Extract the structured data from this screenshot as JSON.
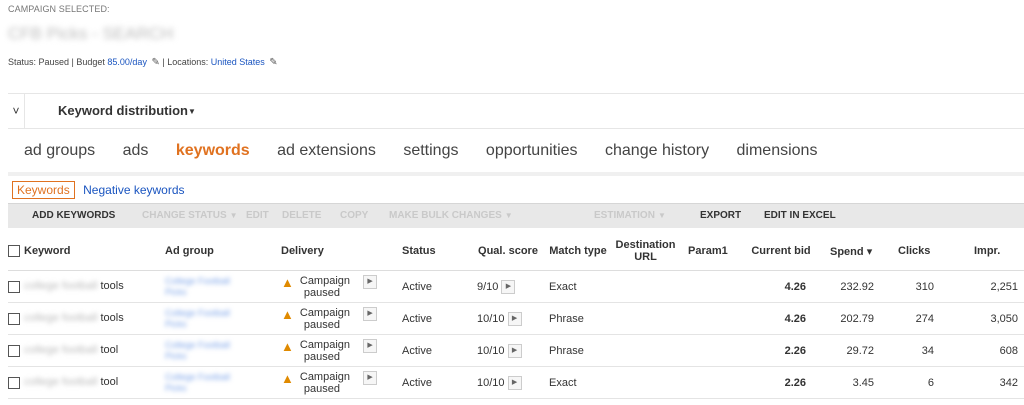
{
  "campaign": {
    "selected_label": "CAMPAIGN SELECTED:",
    "name": "CFB Picks - SEARCH",
    "status_label": "Status: Paused | Budget ",
    "budget": "85.00/day",
    "locations_label": "| Locations: ",
    "location": "United States"
  },
  "keyword_distribution": {
    "toggle": "˅",
    "title": "Keyword distribution"
  },
  "tabs": [
    {
      "label": "ad groups"
    },
    {
      "label": "ads"
    },
    {
      "label": "keywords"
    },
    {
      "label": "ad extensions"
    },
    {
      "label": "settings"
    },
    {
      "label": "opportunities"
    },
    {
      "label": "change history"
    },
    {
      "label": "dimensions"
    }
  ],
  "subtabs": {
    "keywords": "Keywords",
    "negative": "Negative keywords"
  },
  "toolbar": {
    "add_keywords": "ADD KEYWORDS",
    "change_status": "CHANGE STATUS",
    "edit": "EDIT",
    "delete": "DELETE",
    "copy": "COPY",
    "make_bulk_changes": "MAKE BULK CHANGES",
    "estimation": "ESTIMATION",
    "export": "EXPORT",
    "edit_in_excel": "EDIT IN EXCEL"
  },
  "columns": {
    "keyword": "Keyword",
    "ad_group": "Ad group",
    "delivery": "Delivery",
    "status": "Status",
    "qual_score": "Qual. score",
    "match_type": "Match type",
    "destination_url": "Destination URL",
    "param1": "Param1",
    "current_bid": "Current bid",
    "spend": "Spend",
    "clicks": "Clicks",
    "impr": "Impr."
  },
  "rows": [
    {
      "kw_blur": "college football",
      "kw": "tools",
      "ad_group_a": "College Football",
      "ad_group_b": "Picks",
      "delivery_a": "Campaign",
      "delivery_b": "paused",
      "status": "Active",
      "qual": "9/10",
      "match": "Exact",
      "dest": "",
      "param1": "",
      "bid": "4.26",
      "spend": "232.92",
      "clicks": "310",
      "impr": "2,251"
    },
    {
      "kw_blur": "college football",
      "kw": "tools",
      "ad_group_a": "College Football",
      "ad_group_b": "Picks",
      "delivery_a": "Campaign",
      "delivery_b": "paused",
      "status": "Active",
      "qual": "10/10",
      "match": "Phrase",
      "dest": "",
      "param1": "",
      "bid": "4.26",
      "spend": "202.79",
      "clicks": "274",
      "impr": "3,050"
    },
    {
      "kw_blur": "college football",
      "kw": "tool",
      "ad_group_a": "College Football",
      "ad_group_b": "Picks",
      "delivery_a": "Campaign",
      "delivery_b": "paused",
      "status": "Active",
      "qual": "10/10",
      "match": "Phrase",
      "dest": "",
      "param1": "",
      "bid": "2.26",
      "spend": "29.72",
      "clicks": "34",
      "impr": "608"
    },
    {
      "kw_blur": "college football",
      "kw": "tool",
      "ad_group_a": "College Football",
      "ad_group_b": "Picks",
      "delivery_a": "Campaign",
      "delivery_b": "paused",
      "status": "Active",
      "qual": "10/10",
      "match": "Exact",
      "dest": "",
      "param1": "",
      "bid": "2.26",
      "spend": "3.45",
      "clicks": "6",
      "impr": "342"
    }
  ]
}
